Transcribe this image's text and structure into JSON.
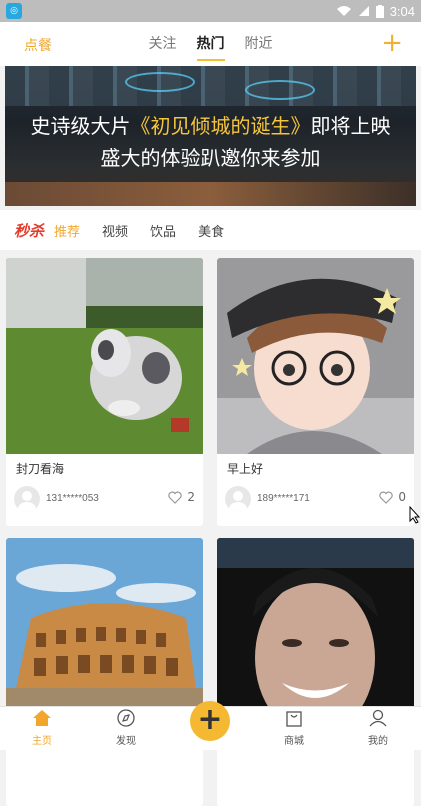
{
  "status": {
    "time": "3:04",
    "app_icon": "app-icon"
  },
  "topnav": {
    "left_label": "点餐",
    "tabs": [
      {
        "label": "关注"
      },
      {
        "label": "热门",
        "active": true
      },
      {
        "label": "附近"
      }
    ],
    "add_icon": "plus-icon"
  },
  "banner": {
    "line1_pre": "史诗级大片",
    "line1_highlight": "《初见倾城的诞生》",
    "line1_post": "即将上映",
    "line2": "盛大的体验趴邀你来参加"
  },
  "categories": {
    "miaosha": "秒杀",
    "items": [
      {
        "label": "推荐",
        "active": true
      },
      {
        "label": "视频"
      },
      {
        "label": "饮品"
      },
      {
        "label": "美食"
      }
    ]
  },
  "cards": [
    {
      "title": "封刀看海",
      "user": "131*****053",
      "likes": "2",
      "image": "dog-photo"
    },
    {
      "title": "早上好",
      "user": "189*****171",
      "likes": "0",
      "image": "cartoon-boy"
    },
    {
      "title": "",
      "user": "",
      "likes": "",
      "image": "colosseum-photo"
    },
    {
      "title": "",
      "user": "",
      "likes": "",
      "image": "man-smiling-photo"
    }
  ],
  "bottombar": {
    "items": [
      {
        "label": "主页",
        "icon": "home-icon",
        "active": true
      },
      {
        "label": "发现",
        "icon": "compass-icon"
      },
      {
        "label": "商城",
        "icon": "shopping-bag-icon"
      },
      {
        "label": "我的",
        "icon": "user-icon"
      }
    ],
    "center_icon": "plus-icon"
  },
  "colors": {
    "accent": "#f2a72c",
    "miaosha": "#e33b2b",
    "highlight": "#f5c63c"
  }
}
